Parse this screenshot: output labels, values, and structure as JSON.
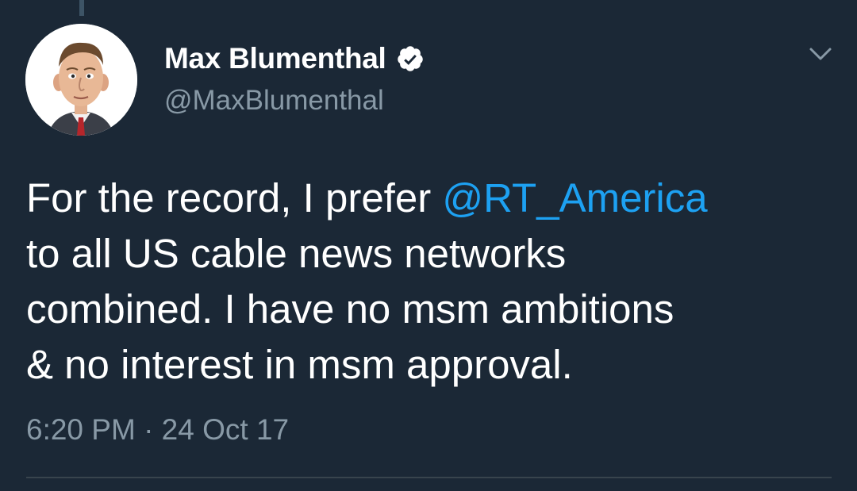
{
  "tweet": {
    "author": {
      "display_name": "Max Blumenthal",
      "handle": "@MaxBlumenthal",
      "verified": true,
      "avatar_icon": "caricature-portrait-avatar"
    },
    "text": {
      "line1_before": "For the record, I prefer ",
      "mention": "@RT_America",
      "line2": "to all US cable news networks",
      "line3": "combined. I have no msm ambitions",
      "line4": "& no interest in msm approval."
    },
    "timestamp": "6:20 PM · 24 Oct 17",
    "menu_icon": "chevron-down-icon"
  },
  "colors": {
    "background": "#1b2836",
    "text_primary": "#ffffff",
    "text_secondary": "#8899a6",
    "mention": "#1da1f2",
    "divider": "#38444d"
  }
}
